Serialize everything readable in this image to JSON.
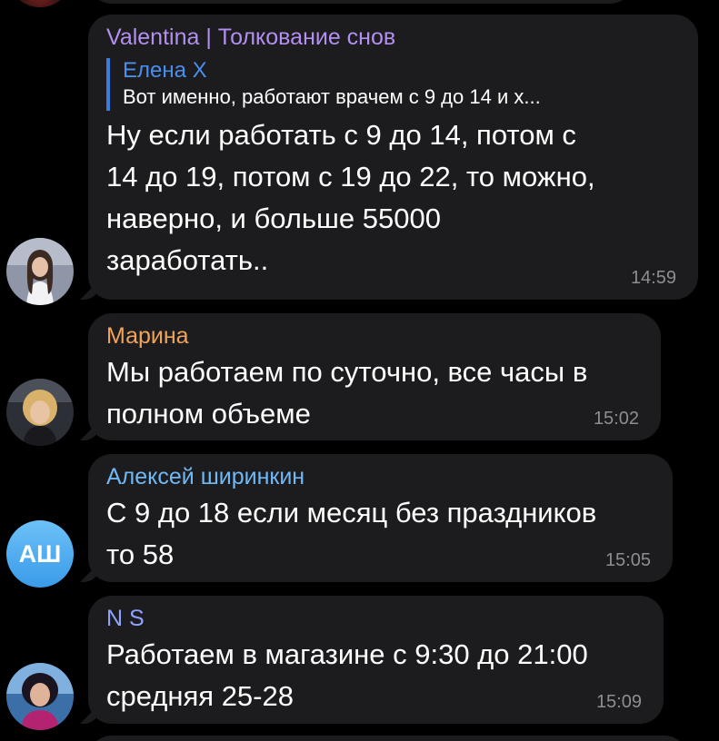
{
  "messages": [
    {
      "sender": "Valentina | Толкование снов",
      "sender_color": "#b28ff0",
      "reply": {
        "author": "Елена Х",
        "text": "Вот именно, работают врачем с 9 до 14 и х..."
      },
      "lines": [
        "Ну если работать с 9 до 14, потом с",
        "14 до 19, потом с 19 до 22, то можно,",
        "наверно, и больше 55000",
        "заработать.."
      ],
      "time": "14:59",
      "avatar_icon": "user-photo-avatar"
    },
    {
      "sender": "Марина",
      "sender_color": "#f0a35b",
      "lines": [
        "Мы работаем по суточно, все часы в",
        "полном объеме"
      ],
      "time": "15:02",
      "avatar_icon": "user-photo-avatar"
    },
    {
      "sender": "Алексей ширинкин",
      "sender_color": "#71b8f5",
      "lines": [
        "С 9 до 18 если месяц без праздников",
        "то 58"
      ],
      "time": "15:05",
      "avatar_initials": "АШ"
    },
    {
      "sender": "N S",
      "sender_color": "#8fa2ff",
      "lines": [
        "Работаем в магазине с 9:30 до 21:00",
        "средняя 25-28"
      ],
      "time": "15:09",
      "avatar_icon": "user-photo-avatar"
    }
  ],
  "colors": {
    "background": "#000000",
    "bubble": "#1c1c1e",
    "timestamp": "#8d8d93",
    "reply_bar": "#3a7bdc"
  }
}
